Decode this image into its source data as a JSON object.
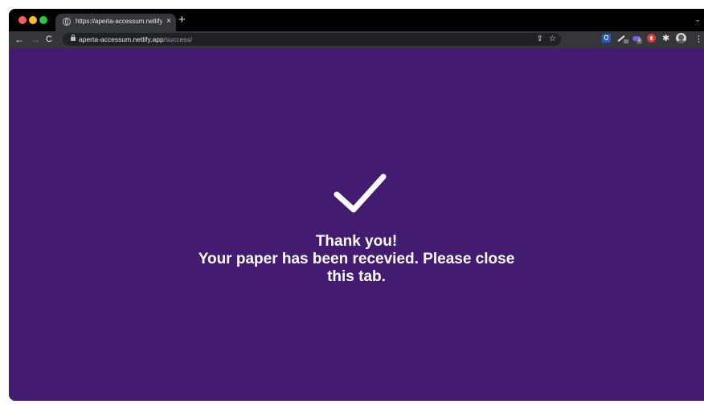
{
  "browser": {
    "tab": {
      "title": "https://aperta-accessum.netlify.app/success/",
      "close_label": "×"
    },
    "new_tab_label": "+",
    "tab_list_label": "⌄",
    "nav": {
      "back_label": "←",
      "forward_label": "→",
      "reload_label": "C"
    },
    "omnibox": {
      "host": "aperta-accessum.netlify.app",
      "path": "/success/"
    },
    "extensions": [
      {
        "name": "bitwarden-icon"
      },
      {
        "name": "pencil-icon"
      },
      {
        "name": "purple-extension-icon",
        "badge": "8"
      },
      {
        "name": "red-extension-icon"
      },
      {
        "name": "puzzle-icon"
      }
    ],
    "menu_label": "⋮",
    "puzzle_label": "✱"
  },
  "page": {
    "background_color": "#431c71",
    "text_color": "#ffffff",
    "icon": "checkmark-icon",
    "thank_you": "Thank you!",
    "message_line1": "Your paper has been recevied. Please close",
    "message_line2": "this tab."
  }
}
